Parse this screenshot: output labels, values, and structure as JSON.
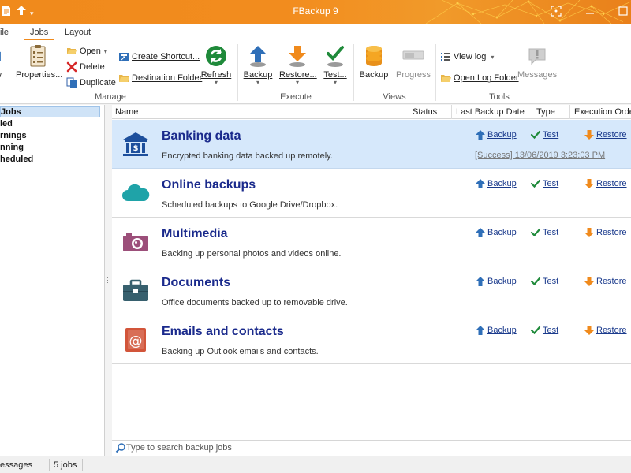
{
  "window": {
    "title": "FBackup 9"
  },
  "ribbon_tabs": [
    {
      "label": "ile"
    },
    {
      "label": "Jobs"
    },
    {
      "label": "Layout"
    }
  ],
  "ribbon": {
    "manage": {
      "label": "Manage",
      "new_label": "w",
      "properties_label": "Properties...",
      "open_label": "Open",
      "delete_label": "Delete",
      "duplicate_label": "Duplicate",
      "create_shortcut_label": "Create Shortcut...",
      "destination_folder_label": "Destination Folder",
      "refresh_label": "Refresh"
    },
    "execute": {
      "label": "Execute",
      "backup_label": "Backup",
      "restore_label": "Restore...",
      "test_label": "Test..."
    },
    "views": {
      "label": "Views",
      "backup_label": "Backup",
      "progress_label": "Progress"
    },
    "tools": {
      "label": "Tools",
      "view_log_label": "View log",
      "open_log_folder_label": "Open Log Folder",
      "messages_label": "Messages"
    }
  },
  "sidebar": {
    "items": [
      {
        "label": "Jobs"
      },
      {
        "label": "ied"
      },
      {
        "label": "rnings"
      },
      {
        "label": "nning"
      },
      {
        "label": "heduled"
      }
    ]
  },
  "columns": {
    "name": "Name",
    "status": "Status",
    "last_backup_date": "Last Backup Date",
    "type": "Type",
    "execution_order": "Execution Order"
  },
  "actions": {
    "backup": "Backup",
    "test": "Test",
    "restore": "Restore"
  },
  "jobs": [
    {
      "name": "Banking data",
      "description": "Encrypted banking data backed up remotely.",
      "icon": "bank-icon",
      "status": "[Success] 13/06/2019 3:23:03 PM"
    },
    {
      "name": "Online backups",
      "description": "Scheduled backups to Google Drive/Dropbox.",
      "icon": "cloud-icon",
      "status": ""
    },
    {
      "name": "Multimedia",
      "description": "Backing up personal photos and videos online.",
      "icon": "camera-icon",
      "status": ""
    },
    {
      "name": "Documents",
      "description": "Office documents backed up to removable drive.",
      "icon": "briefcase-icon",
      "status": ""
    },
    {
      "name": "Emails and contacts",
      "description": "Backing up Outlook emails and contacts.",
      "icon": "email-book-icon",
      "status": ""
    }
  ],
  "search": {
    "placeholder": "Type to search backup jobs"
  },
  "statusbar": {
    "messages": "essages",
    "jobs_count": "5 jobs"
  },
  "colors": {
    "accent": "#f08a1c",
    "selected_row": "#d6e8fb",
    "job_title": "#1a2a8c"
  }
}
